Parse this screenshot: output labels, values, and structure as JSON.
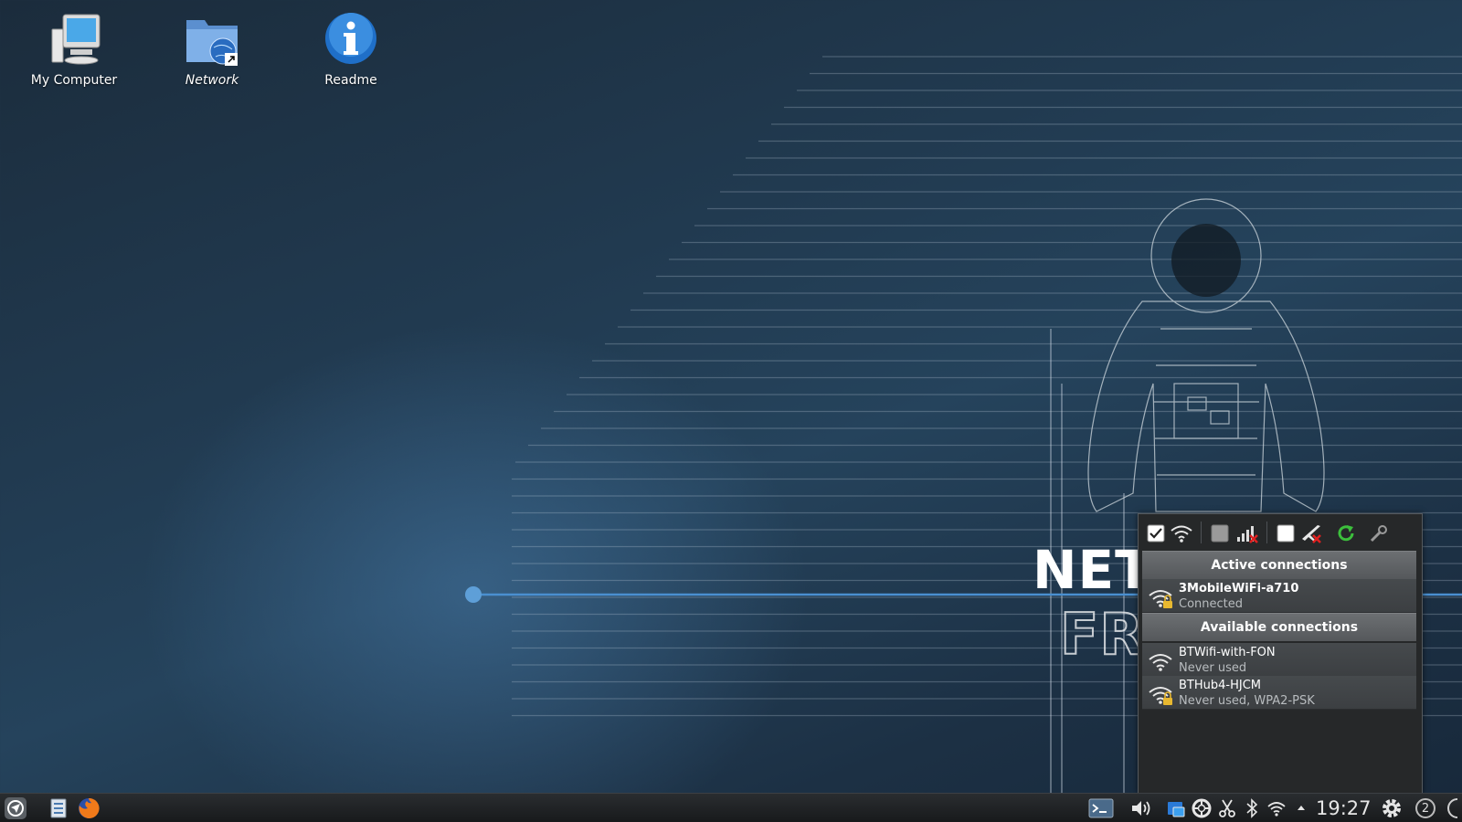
{
  "desktop": {
    "icons": [
      {
        "label": "My Computer",
        "icon": "computer-icon"
      },
      {
        "label": "Network",
        "icon": "network-folder-icon"
      },
      {
        "label": "Readme",
        "icon": "info-icon"
      }
    ],
    "wallpaper_text": [
      "NET",
      "FR"
    ]
  },
  "network_popup": {
    "toolbar": [
      {
        "icon": "checkbox-checked-icon"
      },
      {
        "icon": "wifi-icon"
      },
      {
        "icon": "checkbox-unchecked-icon"
      },
      {
        "icon": "mobile-signal-disabled-icon"
      },
      {
        "icon": "checkbox-unchecked-icon"
      },
      {
        "icon": "airplane-mode-disabled-icon"
      },
      {
        "icon": "refresh-icon"
      },
      {
        "icon": "wrench-icon"
      }
    ],
    "active_header": "Active connections",
    "active": [
      {
        "name": "3MobileWiFi-a710",
        "status": "Connected",
        "secured": true
      }
    ],
    "available_header": "Available connections",
    "available": [
      {
        "name": "BTWifi-with-FON",
        "status": "Never used",
        "secured": false
      },
      {
        "name": "BTHub4-HJCM",
        "status": "Never used, WPA2-PSK",
        "secured": true
      }
    ]
  },
  "taskbar": {
    "left": [
      {
        "icon": "application-menu-icon"
      },
      {
        "icon": "file-manager-icon"
      },
      {
        "icon": "firefox-icon"
      }
    ],
    "tray": [
      {
        "icon": "terminal-icon"
      },
      {
        "icon": "volume-icon"
      },
      {
        "icon": "screenshot-icon"
      },
      {
        "icon": "lifebuoy-icon"
      },
      {
        "icon": "scissors-icon"
      },
      {
        "icon": "bluetooth-icon"
      },
      {
        "icon": "wifi-tray-icon"
      },
      {
        "icon": "expand-tray-icon"
      }
    ],
    "clock": "19:27",
    "workspace_number": "2"
  },
  "colors": {
    "accent_line": "#4a8fd0",
    "refresh_green": "#3cbf3c",
    "disabled_red": "#e02020",
    "lock_yellow": "#e8b830"
  }
}
